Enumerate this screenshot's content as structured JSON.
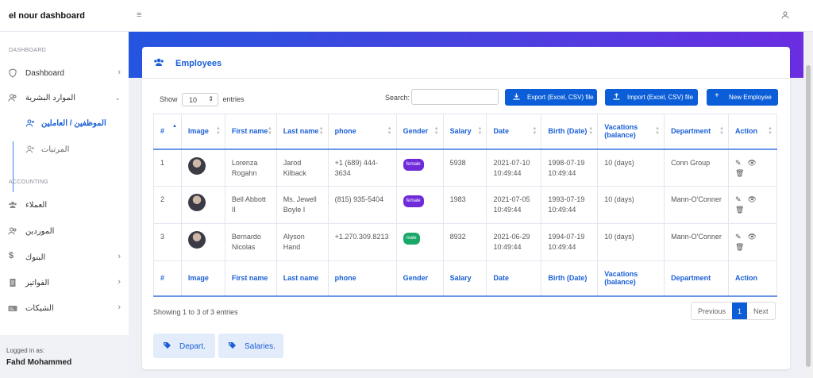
{
  "app": {
    "title": "el nour dashboard"
  },
  "sidebar": {
    "section_dashboard": "DASHBOARD",
    "section_accounting": "ACCOUNTING",
    "items": [
      {
        "label": "Dashboard"
      },
      {
        "label": "الموارد البشرية"
      },
      {
        "label": "الموظفين / العاملين"
      },
      {
        "label": "المرتبات"
      },
      {
        "label": "العملاء"
      },
      {
        "label": "الموردين"
      },
      {
        "label": "البنوك"
      },
      {
        "label": "الفواتير"
      },
      {
        "label": "الشيكات"
      }
    ],
    "footer": {
      "logged_in_label": "Logged in as:",
      "user_name": "Fahd Mohammed"
    }
  },
  "card": {
    "title": "Employees",
    "show_label": "Show",
    "entries_value": "10",
    "entries_label": "entries",
    "search_label": "Search:",
    "search_value": "",
    "buttons": {
      "export": "Export (Excel, CSV) file",
      "import": "Import (Excel, CSV) file",
      "new": "New Employee"
    }
  },
  "table": {
    "headers": [
      "#",
      "Image",
      "First name",
      "Last name",
      "phone",
      "Gender",
      "Salary",
      "Date",
      "Birth (Date)",
      "Vacations (balance)",
      "Department",
      "Action"
    ],
    "rows": [
      {
        "id": "1",
        "first": "Lorenza Rogahn",
        "last": "Jarod Kilback",
        "phone": "+1 (689) 444-3634",
        "gender": "female",
        "salary": "5938",
        "date": "2021-07-10 10:49:44",
        "birth": "1998-07-19 10:49:44",
        "vacations": "10 (days)",
        "department": "Conn Group"
      },
      {
        "id": "2",
        "first": "Bell Abbott II",
        "last": "Ms. Jewell Boyle I",
        "phone": "(815) 935-5404",
        "gender": "female",
        "salary": "1983",
        "date": "2021-07-05 10:49:44",
        "birth": "1993-07-19 10:49:44",
        "vacations": "10 (days)",
        "department": "Mann-O'Conner"
      },
      {
        "id": "3",
        "first": "Bernardo Nicolas",
        "last": "Alyson Hand",
        "phone": "+1.270.309.8213",
        "gender": "male",
        "salary": "8932",
        "date": "2021-06-29 10:49:44",
        "birth": "1994-07-19 10:49:44",
        "vacations": "10 (days)",
        "department": "Mann-O'Conner"
      }
    ]
  },
  "footer": {
    "info": "Showing 1 to 3 of 3 entries",
    "previous": "Previous",
    "page": "1",
    "next": "Next",
    "depart_button": "Depart.",
    "salaries_button": "Salaries."
  },
  "colors": {
    "primary": "#0b5ed7",
    "female_badge": "#6f2bd9",
    "male_badge": "#1aa868",
    "banner_start": "#2455e0",
    "banner_end": "#6a2ee0"
  }
}
